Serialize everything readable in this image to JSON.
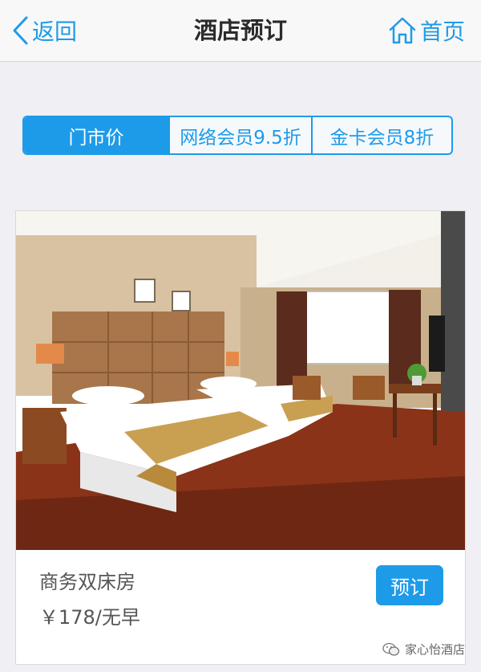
{
  "header": {
    "back_label": "返回",
    "title": "酒店预订",
    "home_label": "首页"
  },
  "tabs": [
    {
      "label": "门市价",
      "active": true
    },
    {
      "label": "网络会员9.5折",
      "active": false
    },
    {
      "label": "金卡会员8折",
      "active": false
    }
  ],
  "room": {
    "name": "商务双床房",
    "price": "￥178/无早",
    "book_label": "预订"
  },
  "watermark": "家心怡酒店",
  "colors": {
    "accent": "#1e9be8",
    "background": "#efeff4",
    "header_bg": "#f8f8f8"
  }
}
